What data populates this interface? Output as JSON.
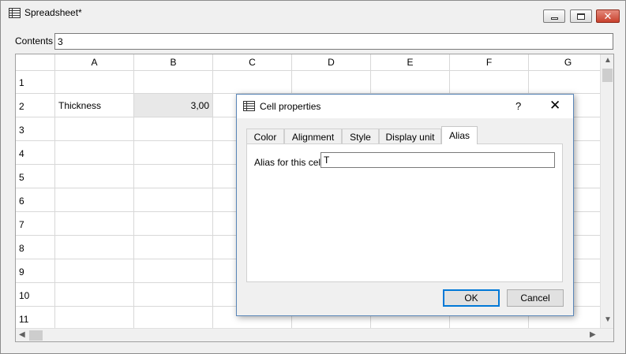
{
  "window": {
    "title": "Spreadsheet*"
  },
  "contents": {
    "label": "Contents",
    "value": "3"
  },
  "columns": [
    "A",
    "B",
    "C",
    "D",
    "E",
    "F",
    "G"
  ],
  "rows": [
    "1",
    "2",
    "3",
    "4",
    "5",
    "6",
    "7",
    "8",
    "9",
    "10",
    "11"
  ],
  "cells": {
    "A2": "Thickness",
    "B2": "3,00"
  },
  "dialog": {
    "title": "Cell properties",
    "help": "?",
    "close": "✕",
    "tabs": [
      "Color",
      "Alignment",
      "Style",
      "Display unit",
      "Alias"
    ],
    "active_tab": "Alias",
    "alias_label": "Alias for this cell",
    "alias_value": "T",
    "ok_label": "OK",
    "cancel_label": "Cancel"
  },
  "icons": {
    "window": "spreadsheet-icon",
    "dialog": "spreadsheet-icon"
  }
}
